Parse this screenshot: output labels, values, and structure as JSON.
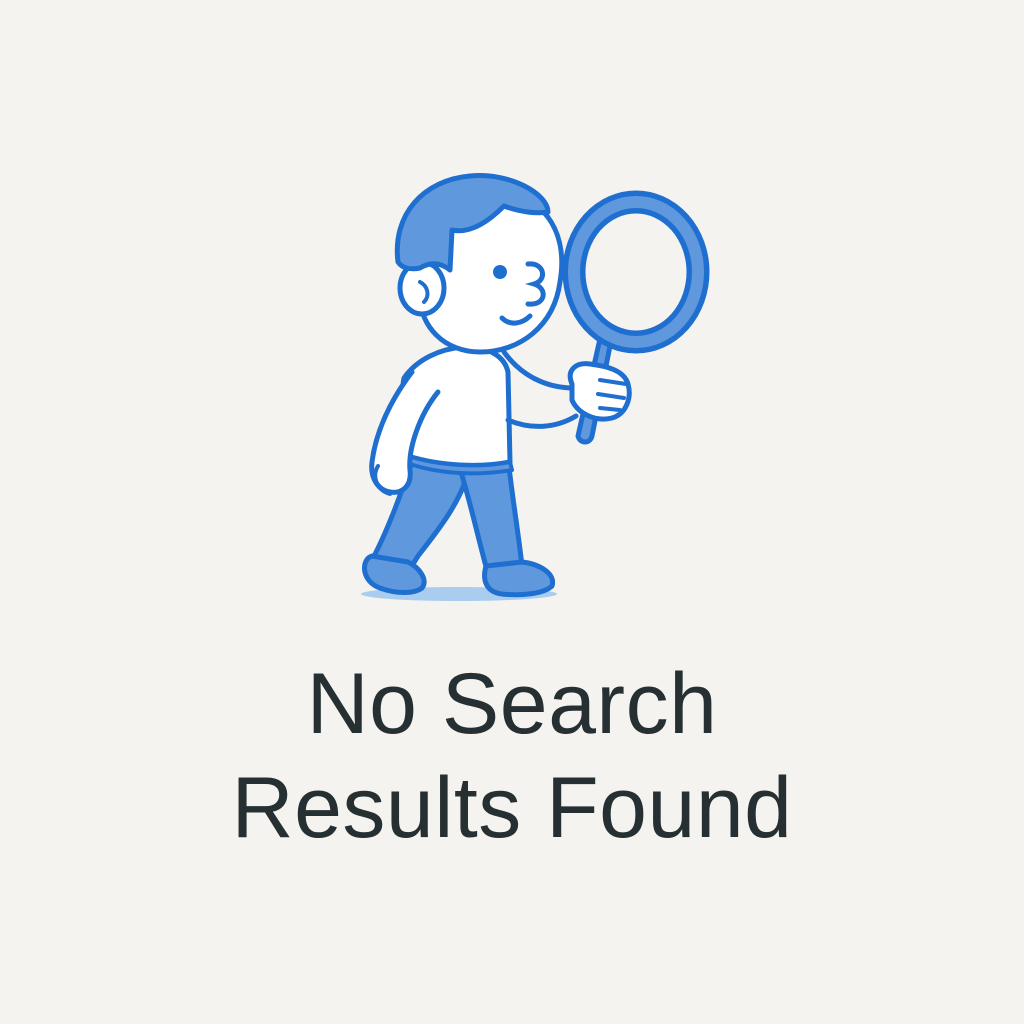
{
  "empty_state": {
    "illustration_icon": "person-with-magnifying-glass-icon",
    "title_line_1": "No Search",
    "title_line_2": "Results Found"
  },
  "colors": {
    "background": "#f5f3ef",
    "outline_blue": "#1f6fd0",
    "fill_blue": "#5f98dc",
    "shadow_blue": "#a9cdee",
    "skin": "#ffffff",
    "title_text": "#263033"
  }
}
